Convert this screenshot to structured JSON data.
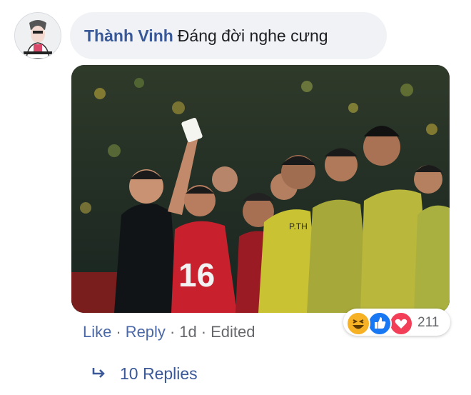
{
  "comment": {
    "author": "Thành Vinh",
    "text": "Đáng đời nghe cưng"
  },
  "actions": {
    "like": "Like",
    "reply": "Reply",
    "time": "1d",
    "edited": "Edited",
    "separator": "·"
  },
  "reactions": {
    "count": "211",
    "types": [
      "haha-icon",
      "like-icon",
      "love-icon"
    ],
    "colors": {
      "haha": "#f7b125",
      "like": "#1877f2",
      "love": "#f33e58"
    }
  },
  "replies": {
    "label": "10 Replies"
  },
  "photo": {
    "shirt_number": "16",
    "shirt_text": "P.TH"
  }
}
